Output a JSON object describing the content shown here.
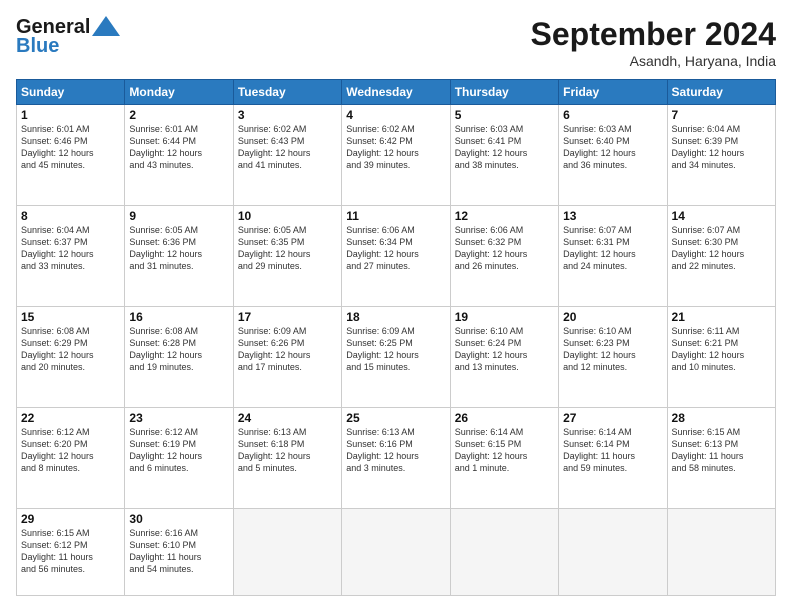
{
  "header": {
    "logo_general": "General",
    "logo_blue": "Blue",
    "month_year": "September 2024",
    "location": "Asandh, Haryana, India"
  },
  "days_of_week": [
    "Sunday",
    "Monday",
    "Tuesday",
    "Wednesday",
    "Thursday",
    "Friday",
    "Saturday"
  ],
  "weeks": [
    [
      {
        "day": "1",
        "lines": [
          "Sunrise: 6:01 AM",
          "Sunset: 6:46 PM",
          "Daylight: 12 hours",
          "and 45 minutes."
        ]
      },
      {
        "day": "2",
        "lines": [
          "Sunrise: 6:01 AM",
          "Sunset: 6:44 PM",
          "Daylight: 12 hours",
          "and 43 minutes."
        ]
      },
      {
        "day": "3",
        "lines": [
          "Sunrise: 6:02 AM",
          "Sunset: 6:43 PM",
          "Daylight: 12 hours",
          "and 41 minutes."
        ]
      },
      {
        "day": "4",
        "lines": [
          "Sunrise: 6:02 AM",
          "Sunset: 6:42 PM",
          "Daylight: 12 hours",
          "and 39 minutes."
        ]
      },
      {
        "day": "5",
        "lines": [
          "Sunrise: 6:03 AM",
          "Sunset: 6:41 PM",
          "Daylight: 12 hours",
          "and 38 minutes."
        ]
      },
      {
        "day": "6",
        "lines": [
          "Sunrise: 6:03 AM",
          "Sunset: 6:40 PM",
          "Daylight: 12 hours",
          "and 36 minutes."
        ]
      },
      {
        "day": "7",
        "lines": [
          "Sunrise: 6:04 AM",
          "Sunset: 6:39 PM",
          "Daylight: 12 hours",
          "and 34 minutes."
        ]
      }
    ],
    [
      {
        "day": "8",
        "lines": [
          "Sunrise: 6:04 AM",
          "Sunset: 6:37 PM",
          "Daylight: 12 hours",
          "and 33 minutes."
        ]
      },
      {
        "day": "9",
        "lines": [
          "Sunrise: 6:05 AM",
          "Sunset: 6:36 PM",
          "Daylight: 12 hours",
          "and 31 minutes."
        ]
      },
      {
        "day": "10",
        "lines": [
          "Sunrise: 6:05 AM",
          "Sunset: 6:35 PM",
          "Daylight: 12 hours",
          "and 29 minutes."
        ]
      },
      {
        "day": "11",
        "lines": [
          "Sunrise: 6:06 AM",
          "Sunset: 6:34 PM",
          "Daylight: 12 hours",
          "and 27 minutes."
        ]
      },
      {
        "day": "12",
        "lines": [
          "Sunrise: 6:06 AM",
          "Sunset: 6:32 PM",
          "Daylight: 12 hours",
          "and 26 minutes."
        ]
      },
      {
        "day": "13",
        "lines": [
          "Sunrise: 6:07 AM",
          "Sunset: 6:31 PM",
          "Daylight: 12 hours",
          "and 24 minutes."
        ]
      },
      {
        "day": "14",
        "lines": [
          "Sunrise: 6:07 AM",
          "Sunset: 6:30 PM",
          "Daylight: 12 hours",
          "and 22 minutes."
        ]
      }
    ],
    [
      {
        "day": "15",
        "lines": [
          "Sunrise: 6:08 AM",
          "Sunset: 6:29 PM",
          "Daylight: 12 hours",
          "and 20 minutes."
        ]
      },
      {
        "day": "16",
        "lines": [
          "Sunrise: 6:08 AM",
          "Sunset: 6:28 PM",
          "Daylight: 12 hours",
          "and 19 minutes."
        ]
      },
      {
        "day": "17",
        "lines": [
          "Sunrise: 6:09 AM",
          "Sunset: 6:26 PM",
          "Daylight: 12 hours",
          "and 17 minutes."
        ]
      },
      {
        "day": "18",
        "lines": [
          "Sunrise: 6:09 AM",
          "Sunset: 6:25 PM",
          "Daylight: 12 hours",
          "and 15 minutes."
        ]
      },
      {
        "day": "19",
        "lines": [
          "Sunrise: 6:10 AM",
          "Sunset: 6:24 PM",
          "Daylight: 12 hours",
          "and 13 minutes."
        ]
      },
      {
        "day": "20",
        "lines": [
          "Sunrise: 6:10 AM",
          "Sunset: 6:23 PM",
          "Daylight: 12 hours",
          "and 12 minutes."
        ]
      },
      {
        "day": "21",
        "lines": [
          "Sunrise: 6:11 AM",
          "Sunset: 6:21 PM",
          "Daylight: 12 hours",
          "and 10 minutes."
        ]
      }
    ],
    [
      {
        "day": "22",
        "lines": [
          "Sunrise: 6:12 AM",
          "Sunset: 6:20 PM",
          "Daylight: 12 hours",
          "and 8 minutes."
        ]
      },
      {
        "day": "23",
        "lines": [
          "Sunrise: 6:12 AM",
          "Sunset: 6:19 PM",
          "Daylight: 12 hours",
          "and 6 minutes."
        ]
      },
      {
        "day": "24",
        "lines": [
          "Sunrise: 6:13 AM",
          "Sunset: 6:18 PM",
          "Daylight: 12 hours",
          "and 5 minutes."
        ]
      },
      {
        "day": "25",
        "lines": [
          "Sunrise: 6:13 AM",
          "Sunset: 6:16 PM",
          "Daylight: 12 hours",
          "and 3 minutes."
        ]
      },
      {
        "day": "26",
        "lines": [
          "Sunrise: 6:14 AM",
          "Sunset: 6:15 PM",
          "Daylight: 12 hours",
          "and 1 minute."
        ]
      },
      {
        "day": "27",
        "lines": [
          "Sunrise: 6:14 AM",
          "Sunset: 6:14 PM",
          "Daylight: 11 hours",
          "and 59 minutes."
        ]
      },
      {
        "day": "28",
        "lines": [
          "Sunrise: 6:15 AM",
          "Sunset: 6:13 PM",
          "Daylight: 11 hours",
          "and 58 minutes."
        ]
      }
    ],
    [
      {
        "day": "29",
        "lines": [
          "Sunrise: 6:15 AM",
          "Sunset: 6:12 PM",
          "Daylight: 11 hours",
          "and 56 minutes."
        ]
      },
      {
        "day": "30",
        "lines": [
          "Sunrise: 6:16 AM",
          "Sunset: 6:10 PM",
          "Daylight: 11 hours",
          "and 54 minutes."
        ]
      },
      null,
      null,
      null,
      null,
      null
    ]
  ]
}
